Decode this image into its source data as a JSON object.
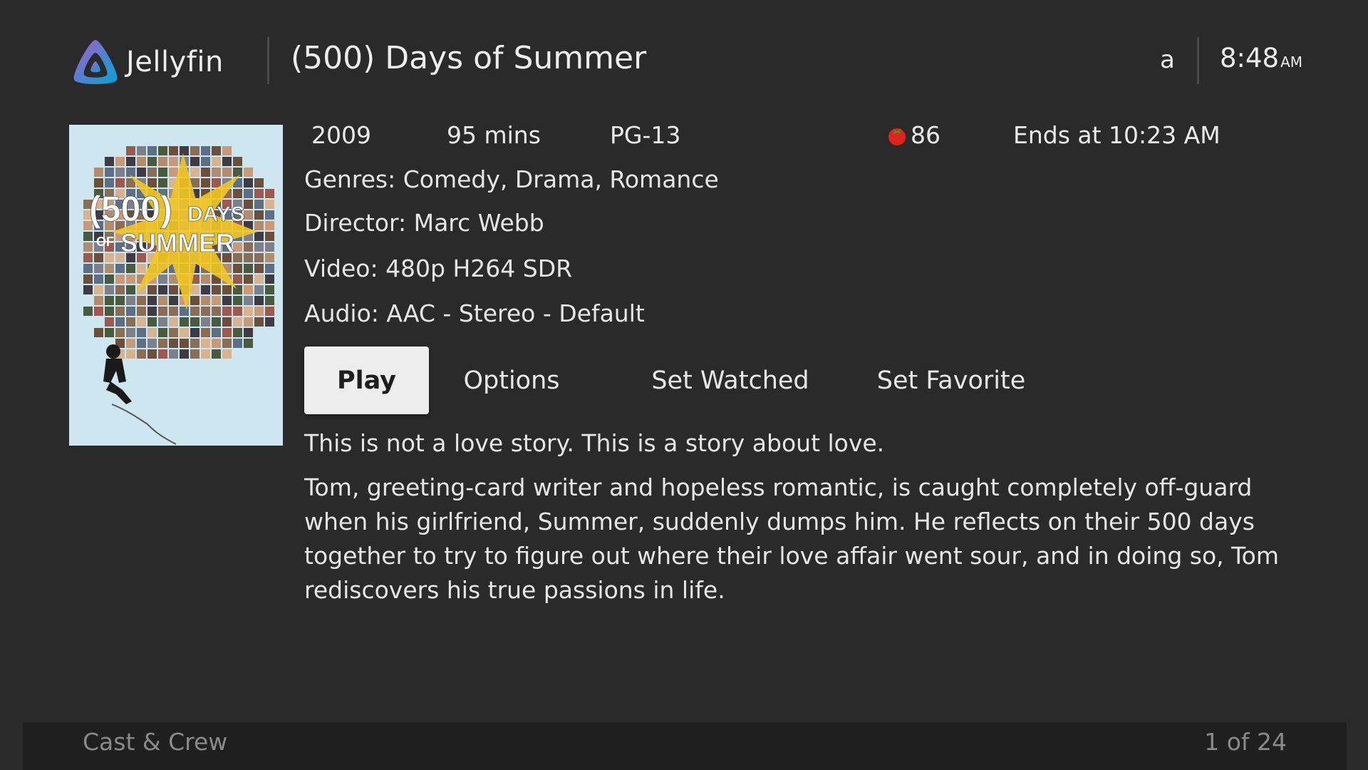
{
  "header": {
    "brand": "Jellyfin",
    "page_title": "(500) Days of Summer",
    "user": "a",
    "time": "8:48",
    "ampm": "AM"
  },
  "poster": {
    "title_line1": "(500)",
    "title_days": "DAYS",
    "title_of": "OF",
    "title_summer": "SUMMER"
  },
  "meta": {
    "year": "2009",
    "runtime": "95 mins",
    "rating": "PG-13",
    "critic_score": "86",
    "ends_at": "Ends at 10:23 AM"
  },
  "info": {
    "genres": "Genres: Comedy, Drama, Romance",
    "director": "Director: Marc Webb",
    "video": "Video: 480p H264 SDR",
    "audio": "Audio: AAC - Stereo - Default"
  },
  "buttons": {
    "play": "Play",
    "options": "Options",
    "set_watched": "Set Watched",
    "set_favorite": "Set Favorite"
  },
  "tagline": "This is not a love story. This is a story about love.",
  "overview": "Tom, greeting-card writer and hopeless romantic, is caught completely off-guard when his girlfriend, Summer, suddenly dumps him. He reflects on their 500 days together to try to figure out where their love affair went sour, and in doing so, Tom rediscovers his true passions in life.",
  "footer": {
    "section_label": "Cast & Crew",
    "counter": "1 of 24"
  },
  "colors": {
    "background": "#2a2a2b",
    "footer_bg": "#1f1f20",
    "play_button_bg": "#ededed",
    "tomato_red": "#e0241b",
    "logo_gradient_start": "#aa5cc3",
    "logo_gradient_end": "#00a4dc"
  }
}
